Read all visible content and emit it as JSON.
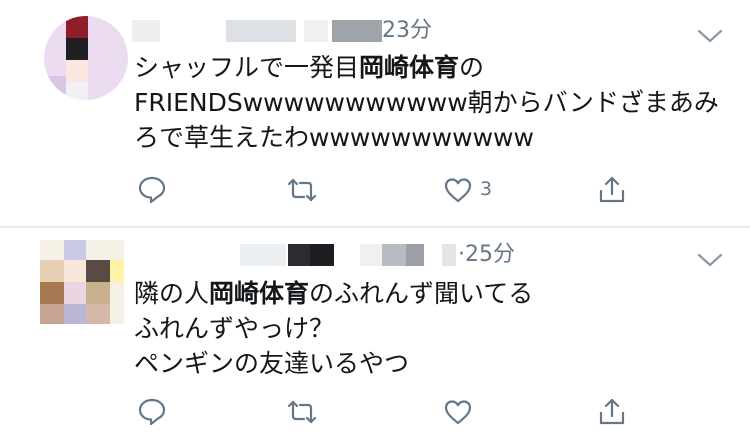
{
  "colors": {
    "text": "#14171a",
    "secondary": "#657786",
    "divider": "#e6ecf0",
    "icon": "#657786"
  },
  "tweets": [
    {
      "time": "23分",
      "lines": [
        [
          {
            "text": "シャッフルで一発目",
            "bold": false
          },
          {
            "text": "岡崎体育",
            "bold": true
          },
          {
            "text": "の",
            "bold": false
          }
        ],
        [
          {
            "text": "FRIENDSwwwwwwwwwww朝からバンドざまあみ",
            "bold": false
          }
        ],
        [
          {
            "text": "ろで草生えたわwwwwwwwwwww",
            "bold": false
          }
        ]
      ],
      "like_count": "3",
      "icons": [
        "reply-icon",
        "retweet-icon",
        "like-icon",
        "share-icon",
        "chevron-down-icon"
      ]
    },
    {
      "time": "·25分",
      "lines": [
        [
          {
            "text": "隣の人",
            "bold": false
          },
          {
            "text": "岡崎体育",
            "bold": true
          },
          {
            "text": "のふれんず聞いてる",
            "bold": false
          }
        ],
        [
          {
            "text": "ふれんずやっけ？",
            "bold": false
          }
        ],
        [
          {
            "text": "ペンギンの友達いるやつ",
            "bold": false
          }
        ]
      ],
      "like_count": "",
      "icons": [
        "reply-icon",
        "retweet-icon",
        "like-icon",
        "share-icon",
        "chevron-down-icon"
      ]
    }
  ]
}
